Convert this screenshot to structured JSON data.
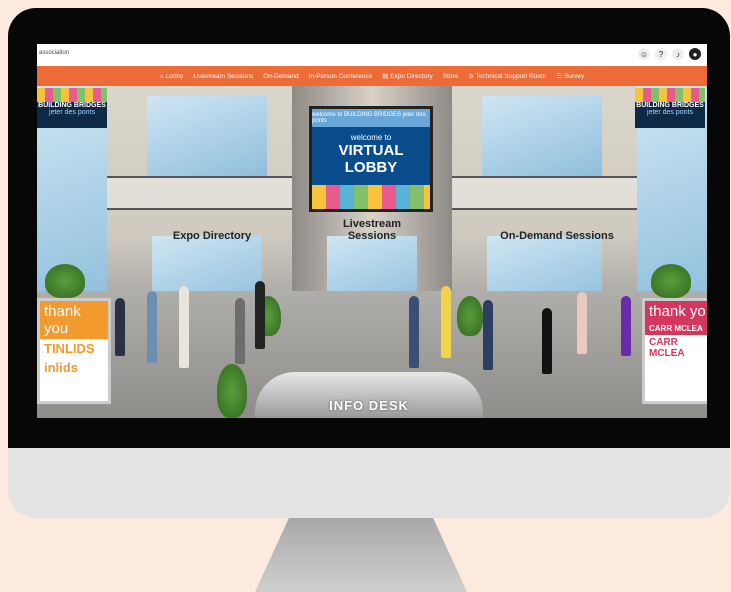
{
  "header": {
    "org_text": "association",
    "icons": [
      "accessibility-icon",
      "help-icon",
      "bell-icon",
      "user-icon"
    ],
    "help_glyph": "?"
  },
  "nav": {
    "items": [
      {
        "label": "Lobby"
      },
      {
        "label": "Livestream Sessions"
      },
      {
        "label": "On-Demand"
      },
      {
        "label": "In-Person Conference"
      },
      {
        "label": "Expo Directory"
      },
      {
        "label": "Store"
      },
      {
        "label": "Technical Support Room"
      },
      {
        "label": "Survey"
      }
    ],
    "color": "#ed6b37"
  },
  "lobby": {
    "main_sign": {
      "banner": "welcome to BUILDING BRIDGES jeter des ponts",
      "line1": "welcome to",
      "line2": "VIRTUAL LOBBY"
    },
    "room_labels": {
      "expo": "Expo Directory",
      "livestream": "Livestream Sessions",
      "ondemand": "On-Demand Sessions"
    },
    "banner_left": {
      "title": "BUILDING BRIDGES",
      "subtitle": "jeter des ponts"
    },
    "banner_right": {
      "title": "BUILDING BRIDGES",
      "subtitle": "jeter des ponts"
    },
    "kiosk_left": {
      "line1": "thank you",
      "line2": "TINLIDS",
      "line3": "inlids"
    },
    "kiosk_right": {
      "line1": "thank yo",
      "line2": "CARR MCLEA",
      "line3": "CARR MCLEA"
    },
    "info_desk": "INFO DESK"
  }
}
